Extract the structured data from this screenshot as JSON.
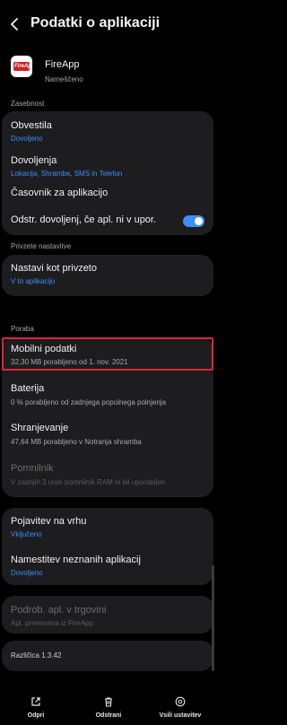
{
  "header": {
    "title": "Podatki o aplikaciji"
  },
  "app": {
    "name": "FireApp",
    "status": "Nameščeno",
    "icon": "fireapp-logo",
    "logo_text": "FireApp"
  },
  "sections": {
    "privacy": "Zasebnost",
    "defaults": "Privzete nastavitve",
    "usage": "Poraba"
  },
  "privacy_card": {
    "notifications": {
      "title": "Obvestila",
      "subtitle": "Dovoljeno"
    },
    "permissions": {
      "title": "Dovoljenja",
      "subtitle": "Lokacija, Shramba, SMS in Telefon"
    },
    "alarms": {
      "title": "Časovnik za aplikacijo"
    },
    "remove_permissions": {
      "title": "Odstr. dovoljenj, če apl. ni v upor.",
      "enabled": true
    }
  },
  "defaults_card": {
    "set_default": {
      "title": "Nastavi kot privzeto",
      "subtitle": "V to aplikacijo"
    }
  },
  "usage_card": {
    "mobile_data": {
      "title": "Mobilni podatki",
      "subtitle": "32,30 MB porabljeno od 1. nov. 2021"
    },
    "battery": {
      "title": "Baterija",
      "subtitle": "0 % porabljeno od zadnjega popolnega polnjenja"
    },
    "storage": {
      "title": "Shranjevanje",
      "subtitle": "47,64 MB porabljeno v Notranja shramba"
    },
    "memory": {
      "title": "Pomnilnik",
      "subtitle": "V zadnjih 3 urah pomnilnik RAM ni bil uporabljen"
    }
  },
  "other_card": {
    "appear_on_top": {
      "title": "Pojavitev na vrhu",
      "subtitle": "Vključeno"
    },
    "install_unknown": {
      "title": "Namestitev neznanih aplikacij",
      "subtitle": "Dovoljeno"
    }
  },
  "store_card": {
    "store_details": {
      "title": "Podrob. apl. v trgovini",
      "subtitle": "Apl. prenesena iz FireApp"
    }
  },
  "version": "Različica 1.3.42",
  "bottom_bar": {
    "open": "Odpri",
    "uninstall": "Odstrani",
    "force_stop": "Vsili ustavitev"
  },
  "colors": {
    "accent": "#3e8ef7",
    "highlight": "#e0263a",
    "card": "#1d1d1f"
  }
}
